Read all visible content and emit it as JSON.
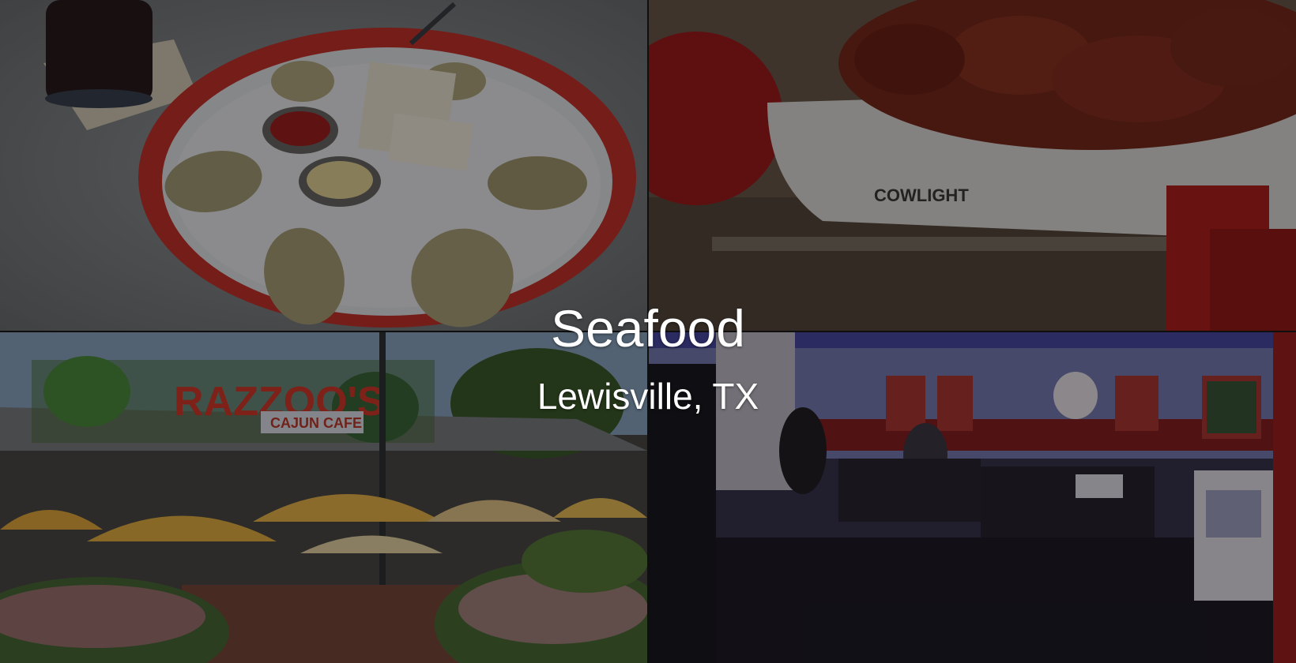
{
  "title": "Seafood",
  "subtitle": "Lewisville, TX",
  "photos": {
    "top_left": "oysters-on-ice-photo",
    "top_right": "crawfish-platter-photo",
    "bottom_left": "restaurant-exterior-photo",
    "bottom_right": "restaurant-interior-photo"
  },
  "signage": {
    "restaurant_name": "RAZZOO'S",
    "restaurant_tag": "CAJUN CAFE",
    "platter_brand": "COWLIGHT"
  },
  "colors": {
    "overlay": "#000000",
    "caption": "#ffffff",
    "tray_red": "#c8322c"
  }
}
